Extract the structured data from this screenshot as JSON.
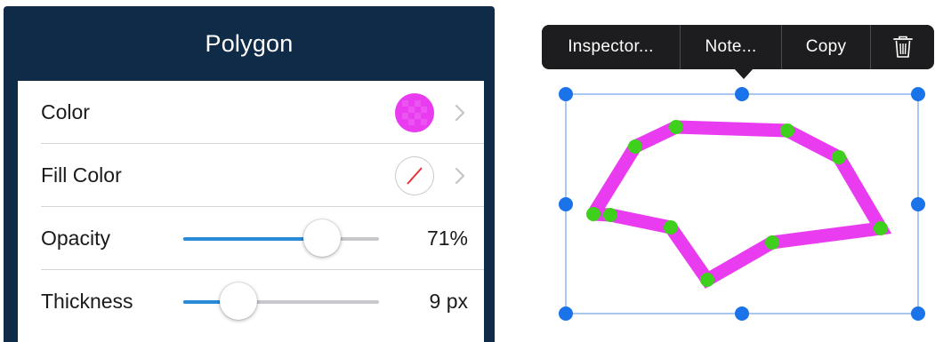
{
  "inspector": {
    "title": "Polygon",
    "rows": [
      {
        "label": "Color",
        "swatch": "#e93cf0"
      },
      {
        "label": "Fill Color",
        "swatch": "none"
      },
      {
        "label": "Opacity",
        "value": "71%",
        "level": 0.71
      },
      {
        "label": "Thickness",
        "value": "9 px",
        "level": 0.28
      }
    ]
  },
  "popup": {
    "inspector_label": "Inspector...",
    "note_label": "Note...",
    "copy_label": "Copy",
    "delete_icon": "trash-icon"
  },
  "colors": {
    "panel_bg": "#0f2b47",
    "stroke": "#e93cf0",
    "vertex": "#3ed01c",
    "handle": "#1a73e8",
    "slider_fill": "#2a8ad8"
  }
}
